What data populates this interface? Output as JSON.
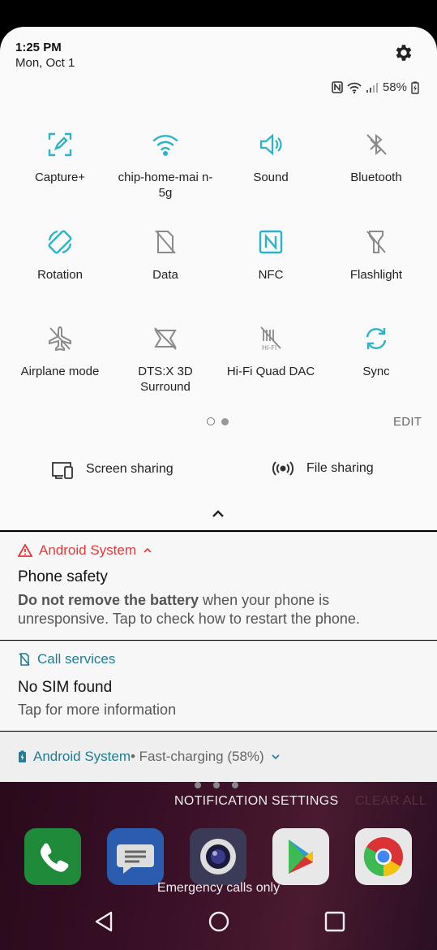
{
  "header": {
    "time": "1:25 PM",
    "date": "Mon, Oct 1",
    "battery": "58%"
  },
  "tiles": [
    {
      "label": "Capture+",
      "icon": "capture-plus-icon",
      "active": true
    },
    {
      "label": "chip-home-mai n-5g",
      "icon": "wifi-icon",
      "active": true
    },
    {
      "label": "Sound",
      "icon": "sound-icon",
      "active": true
    },
    {
      "label": "Bluetooth",
      "icon": "bluetooth-off-icon",
      "active": false
    },
    {
      "label": "Rotation",
      "icon": "rotation-icon",
      "active": true
    },
    {
      "label": "Data",
      "icon": "data-off-icon",
      "active": false
    },
    {
      "label": "NFC",
      "icon": "nfc-icon",
      "active": true
    },
    {
      "label": "Flashlight",
      "icon": "flashlight-off-icon",
      "active": false
    },
    {
      "label": "Airplane mode",
      "icon": "airplane-off-icon",
      "active": false
    },
    {
      "label": "DTS:X 3D Surround",
      "icon": "dtsx-off-icon",
      "active": false
    },
    {
      "label": "Hi-Fi Quad DAC",
      "icon": "hifi-off-icon",
      "active": false
    },
    {
      "label": "Sync",
      "icon": "sync-icon",
      "active": true
    }
  ],
  "edit_label": "EDIT",
  "share": {
    "screen": "Screen sharing",
    "file": "File sharing"
  },
  "notifications": {
    "n1": {
      "app": "Android System",
      "title": "Phone safety",
      "body_bold": "Do not remove the battery",
      "body_rest": " when your phone is unresponsive. Tap to check how to restart the phone."
    },
    "n2": {
      "app": "Call services",
      "title": "No SIM found",
      "body": "Tap for more information"
    },
    "n3": {
      "app": "Android System",
      "detail": " • Fast-charging (58%)"
    }
  },
  "home": {
    "notification_settings": "NOTIFICATION SETTINGS",
    "clear_all": "CLEAR ALL",
    "emergency": "Emergency calls only"
  },
  "colors": {
    "accent": "#2bb3c9",
    "inactive": "#8a8a8a",
    "alert_red": "#e53935",
    "teal_text": "#1f7d95"
  }
}
